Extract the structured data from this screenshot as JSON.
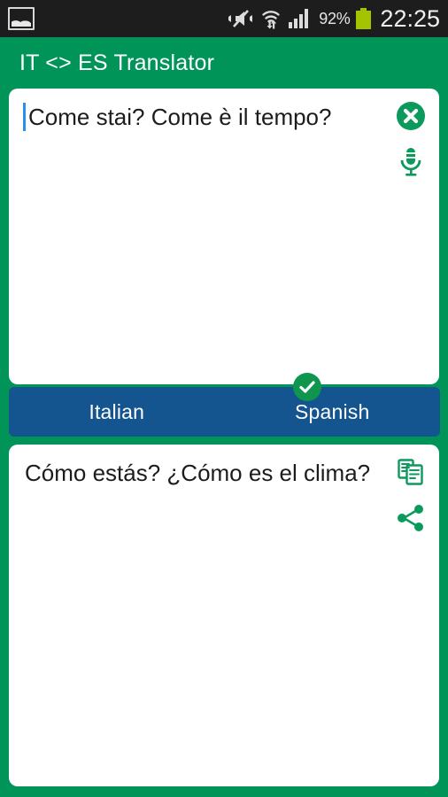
{
  "status_bar": {
    "left_icons": [
      {
        "name": "screenshot-image-icon",
        "label": "image"
      }
    ],
    "right_icons": [
      {
        "name": "vibrate-mute-icon",
        "label": "silent"
      },
      {
        "name": "wifi-icon",
        "label": "wifi"
      },
      {
        "name": "signal-bars-icon",
        "label": "signal"
      }
    ],
    "battery_percent": "92%",
    "battery_color": "#a4c400",
    "time": "22:25",
    "background": "#1d1d1d"
  },
  "app_bar": {
    "title": "IT <> ES Translator",
    "background": "#009459",
    "text_color": "#ffffff"
  },
  "input_card": {
    "text": "Come stai? Come è il tempo?",
    "cursor_visible": true,
    "cursor_color": "#2a8fef",
    "actions": [
      {
        "name": "clear-text-button",
        "icon": "close-circle-icon",
        "label": "Clear"
      },
      {
        "name": "voice-input-button",
        "icon": "microphone-icon",
        "label": "Speak"
      }
    ]
  },
  "language_bar": {
    "background": "#14548f",
    "source": {
      "label": "Italian",
      "selected": false
    },
    "target": {
      "label": "Spanish",
      "selected": true
    },
    "check_badge_color": "#10954e"
  },
  "output_card": {
    "text": "Cómo estás? ¿Cómo es el clima?",
    "actions": [
      {
        "name": "copy-button",
        "icon": "copy-icon",
        "label": "Copy"
      },
      {
        "name": "share-button",
        "icon": "share-icon",
        "label": "Share"
      }
    ]
  },
  "theme": {
    "accent_green": "#009459",
    "icon_green": "#0b9a5c",
    "blue": "#14548f",
    "card_white": "#ffffff",
    "text_dark": "#1c1c1c"
  }
}
